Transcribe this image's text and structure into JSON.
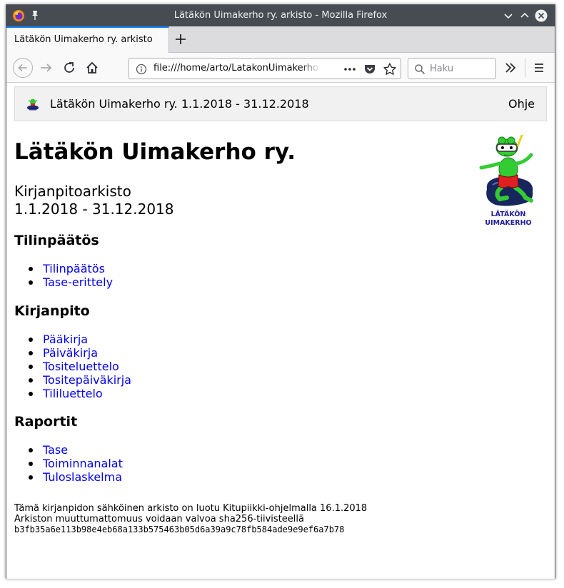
{
  "window": {
    "title": "Lätäkön Uimakerho ry. arkisto - Mozilla Firefox"
  },
  "tabs": [
    {
      "label": "Lätäkön Uimakerho ry. arkisto"
    }
  ],
  "urlbar": {
    "url": "file:///home/arto/LatakonUimakerhory"
  },
  "search": {
    "placeholder": "Haku"
  },
  "icons": {
    "browser": "firefox-logo",
    "pin": "pin-icon",
    "back": "back-arrow-icon",
    "forward": "forward-arrow-icon",
    "reload": "reload-icon",
    "home": "home-icon",
    "info": "info-icon",
    "page_actions": "ellipsis-icon",
    "pocket": "pocket-icon",
    "bookmark": "star-icon",
    "search": "magnifier-icon",
    "overflow": "double-chevron-icon",
    "menu": "hamburger-icon"
  },
  "colors": {
    "titlebar": "#474c53",
    "tab_accent": "#0a84ff",
    "link": "#0000ee",
    "frog_green": "#33cc33",
    "frog_shorts": "#e02020",
    "logo_text": "#1d1d9a"
  },
  "page": {
    "topbar_title": "Lätäkön Uimakerho ry. 1.1.2018 - 31.12.2018",
    "help_link": "Ohje",
    "heading": "Lätäkön Uimakerho ry.",
    "subtitle_line1": "Kirjanpitoarkisto",
    "subtitle_line2": "1.1.2018 - 31.12.2018",
    "logo_text_line1": "LÄTÄKÖN",
    "logo_text_line2": "UIMAKERHO",
    "sections": [
      {
        "title": "Tilinpäätös",
        "links": [
          "Tilinpäätös",
          "Tase-erittely"
        ]
      },
      {
        "title": "Kirjanpito",
        "links": [
          "Pääkirja",
          "Päiväkirja",
          "Tositeluettelo",
          "Tositepäiväkirja",
          "Tililuettelo"
        ]
      },
      {
        "title": "Raportit",
        "links": [
          "Tase",
          "Toiminnanalat",
          "Tuloslaskelma"
        ]
      }
    ],
    "footer_line1": "Tämä kirjanpidon sähköinen arkisto on luotu Kitupiikki-ohjelmalla 16.1.2018",
    "footer_line2": "Arkiston muuttumattomuus voidaan valvoa sha256-tiivisteellä",
    "footer_hash": "b3fb35a6e113b98e4eb68a133b575463b05d6a39a9c78fb584ade9e9ef6a7b78"
  }
}
